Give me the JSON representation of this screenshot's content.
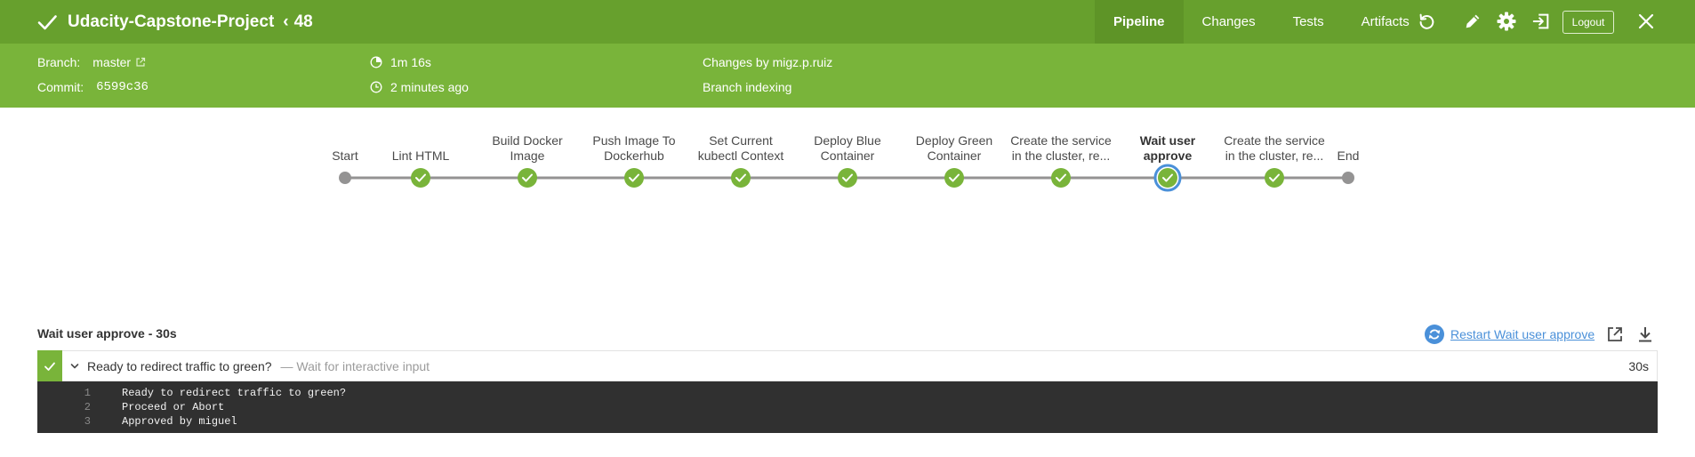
{
  "header": {
    "job_name": "Udacity-Capstone-Project",
    "back_glyph": "‹",
    "run_number": "48",
    "tabs": [
      {
        "label": "Pipeline",
        "active": true
      },
      {
        "label": "Changes",
        "active": false
      },
      {
        "label": "Tests",
        "active": false
      },
      {
        "label": "Artifacts",
        "active": false
      }
    ],
    "logout_label": "Logout",
    "colors": {
      "bar": "#67a02d",
      "active_tab": "#5e9427",
      "info_bar": "#79b43a"
    }
  },
  "info": {
    "branch_key": "Branch:",
    "branch_value": "master",
    "commit_key": "Commit:",
    "commit_value": "6599c36",
    "duration": "1m 16s",
    "started": "2 minutes ago",
    "changes": "Changes by migz.p.ruiz",
    "cause": "Branch indexing"
  },
  "pipeline": {
    "stages": [
      {
        "lines": [
          "Start"
        ],
        "status": "none"
      },
      {
        "lines": [
          "Lint HTML"
        ],
        "status": "success"
      },
      {
        "lines": [
          "Build Docker",
          "Image"
        ],
        "status": "success"
      },
      {
        "lines": [
          "Push Image To",
          "Dockerhub"
        ],
        "status": "success"
      },
      {
        "lines": [
          "Set Current",
          "kubectl Context"
        ],
        "status": "success"
      },
      {
        "lines": [
          "Deploy Blue",
          "Container"
        ],
        "status": "success"
      },
      {
        "lines": [
          "Deploy Green",
          "Container"
        ],
        "status": "success"
      },
      {
        "lines": [
          "Create the service",
          "in the cluster, re..."
        ],
        "status": "success"
      },
      {
        "lines": [
          "Wait user",
          "approve"
        ],
        "status": "selected"
      },
      {
        "lines": [
          "Create the service",
          "in the cluster, re..."
        ],
        "status": "success"
      },
      {
        "lines": [
          "End"
        ],
        "status": "none"
      }
    ],
    "colors": {
      "success": "#79b43a",
      "node_grey": "#949393",
      "selected_ring": "#4a90d9",
      "connector": "#949393"
    }
  },
  "step_panel": {
    "title": "Wait user approve - 30s",
    "restart_label": "Restart Wait user approve",
    "step": {
      "title": "Ready to redirect traffic to green?",
      "description": "— Wait for interactive input",
      "duration": "30s"
    },
    "log": [
      {
        "num": "1",
        "text": "Ready to redirect traffic to green?"
      },
      {
        "num": "2",
        "text": "Proceed or Abort"
      },
      {
        "num": "3",
        "text": "Approved by miguel"
      }
    ]
  },
  "icons": [
    "check-icon",
    "back-chevron-icon",
    "replay-icon",
    "pencil-icon",
    "gear-icon",
    "exit-icon",
    "close-icon",
    "external-link-icon",
    "clock-icon",
    "timer-icon",
    "restart-icon",
    "open-external-icon",
    "download-icon",
    "chevron-down-icon"
  ]
}
